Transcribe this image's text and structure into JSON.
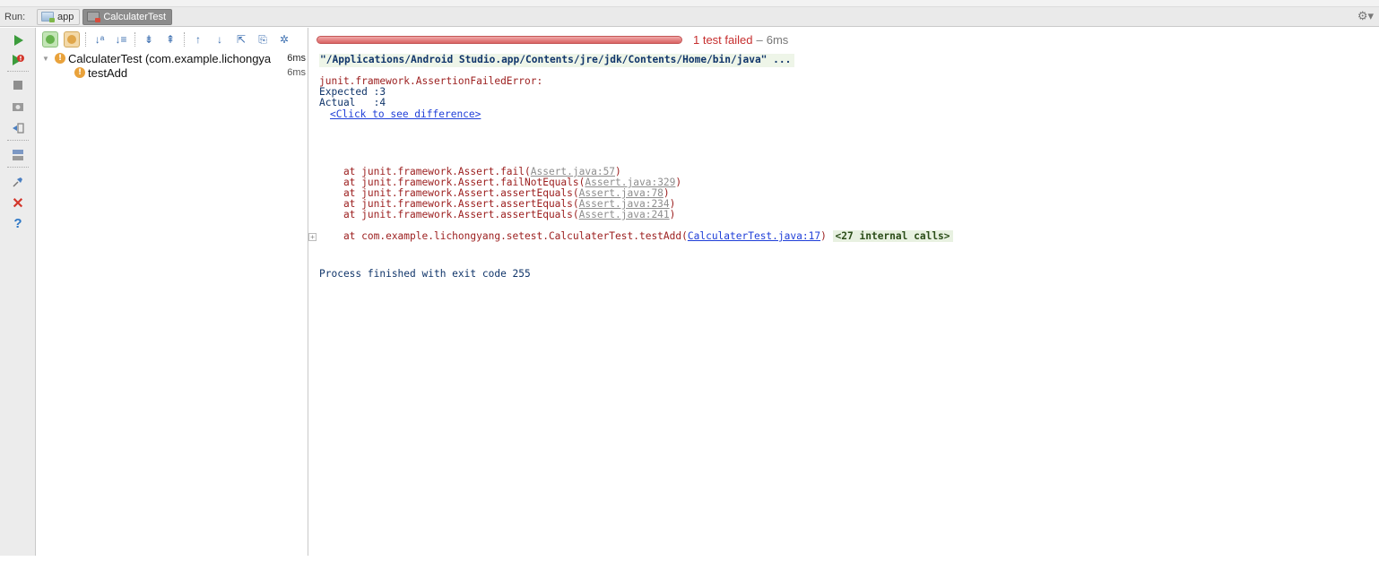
{
  "tab_bar": {
    "run_label": "Run:",
    "tabs": [
      {
        "label": "app",
        "active": false,
        "icon": "android-app-icon"
      },
      {
        "label": "CalculaterTest",
        "active": true,
        "icon": "test-run-icon"
      }
    ],
    "settings_icon": "gear-icon"
  },
  "left_toolbar": {
    "icons": [
      "rerun-icon",
      "rerun-failed-icon",
      "stop-icon",
      "screenshot-icon",
      "restore-layout-icon",
      "layout-icon",
      "pin-icon",
      "close-icon",
      "help-icon"
    ],
    "colors": {
      "play": "#3c9c3c",
      "close": "#d3362b",
      "help": "#2d77c6"
    }
  },
  "tree_toolbar": {
    "icons": [
      "show-passed-icon",
      "show-ignored-icon",
      "sort-alpha-icon",
      "sort-duration-icon",
      "expand-all-icon",
      "collapse-all-icon",
      "prev-failed-icon",
      "next-failed-icon",
      "export-icon",
      "import-icon",
      "settings-icon"
    ]
  },
  "test_tree": [
    {
      "name": "CalculaterTest (com.example.lichongya",
      "time": "6ms",
      "status": "failed",
      "level": 0
    },
    {
      "name": "testAdd",
      "time": "6ms",
      "status": "failed",
      "level": 1
    }
  ],
  "progress": {
    "fraction": 1.0,
    "status_text": "1 test failed",
    "separator": "–",
    "time_text": "6ms",
    "bar_color": "#d96363"
  },
  "console": {
    "command": "\"/Applications/Android Studio.app/Contents/jre/jdk/Contents/Home/bin/java\" ...",
    "error_title": "junit.framework.AssertionFailedError:",
    "expected_line": "Expected :3",
    "actual_line": "Actual   :4",
    "diff_link": "<Click to see difference>",
    "stack": [
      {
        "prefix": "    at junit.framework.Assert.fail(",
        "link": "Assert.java:57",
        "suffix": ")"
      },
      {
        "prefix": "    at junit.framework.Assert.failNotEquals(",
        "link": "Assert.java:329",
        "suffix": ")"
      },
      {
        "prefix": "    at junit.framework.Assert.assertEquals(",
        "link": "Assert.java:78",
        "suffix": ")"
      },
      {
        "prefix": "    at junit.framework.Assert.assertEquals(",
        "link": "Assert.java:234",
        "suffix": ")"
      },
      {
        "prefix": "    at junit.framework.Assert.assertEquals(",
        "link": "Assert.java:241",
        "suffix": ")"
      },
      {
        "prefix": "    at com.example.lichongyang.setest.CalculaterTest.testAdd(",
        "link": "CalculaterTest.java:17",
        "suffix": ") ",
        "internal": "<27 internal calls>"
      }
    ],
    "process_line": "Process finished with exit code 255",
    "fold_glyph": "+"
  }
}
